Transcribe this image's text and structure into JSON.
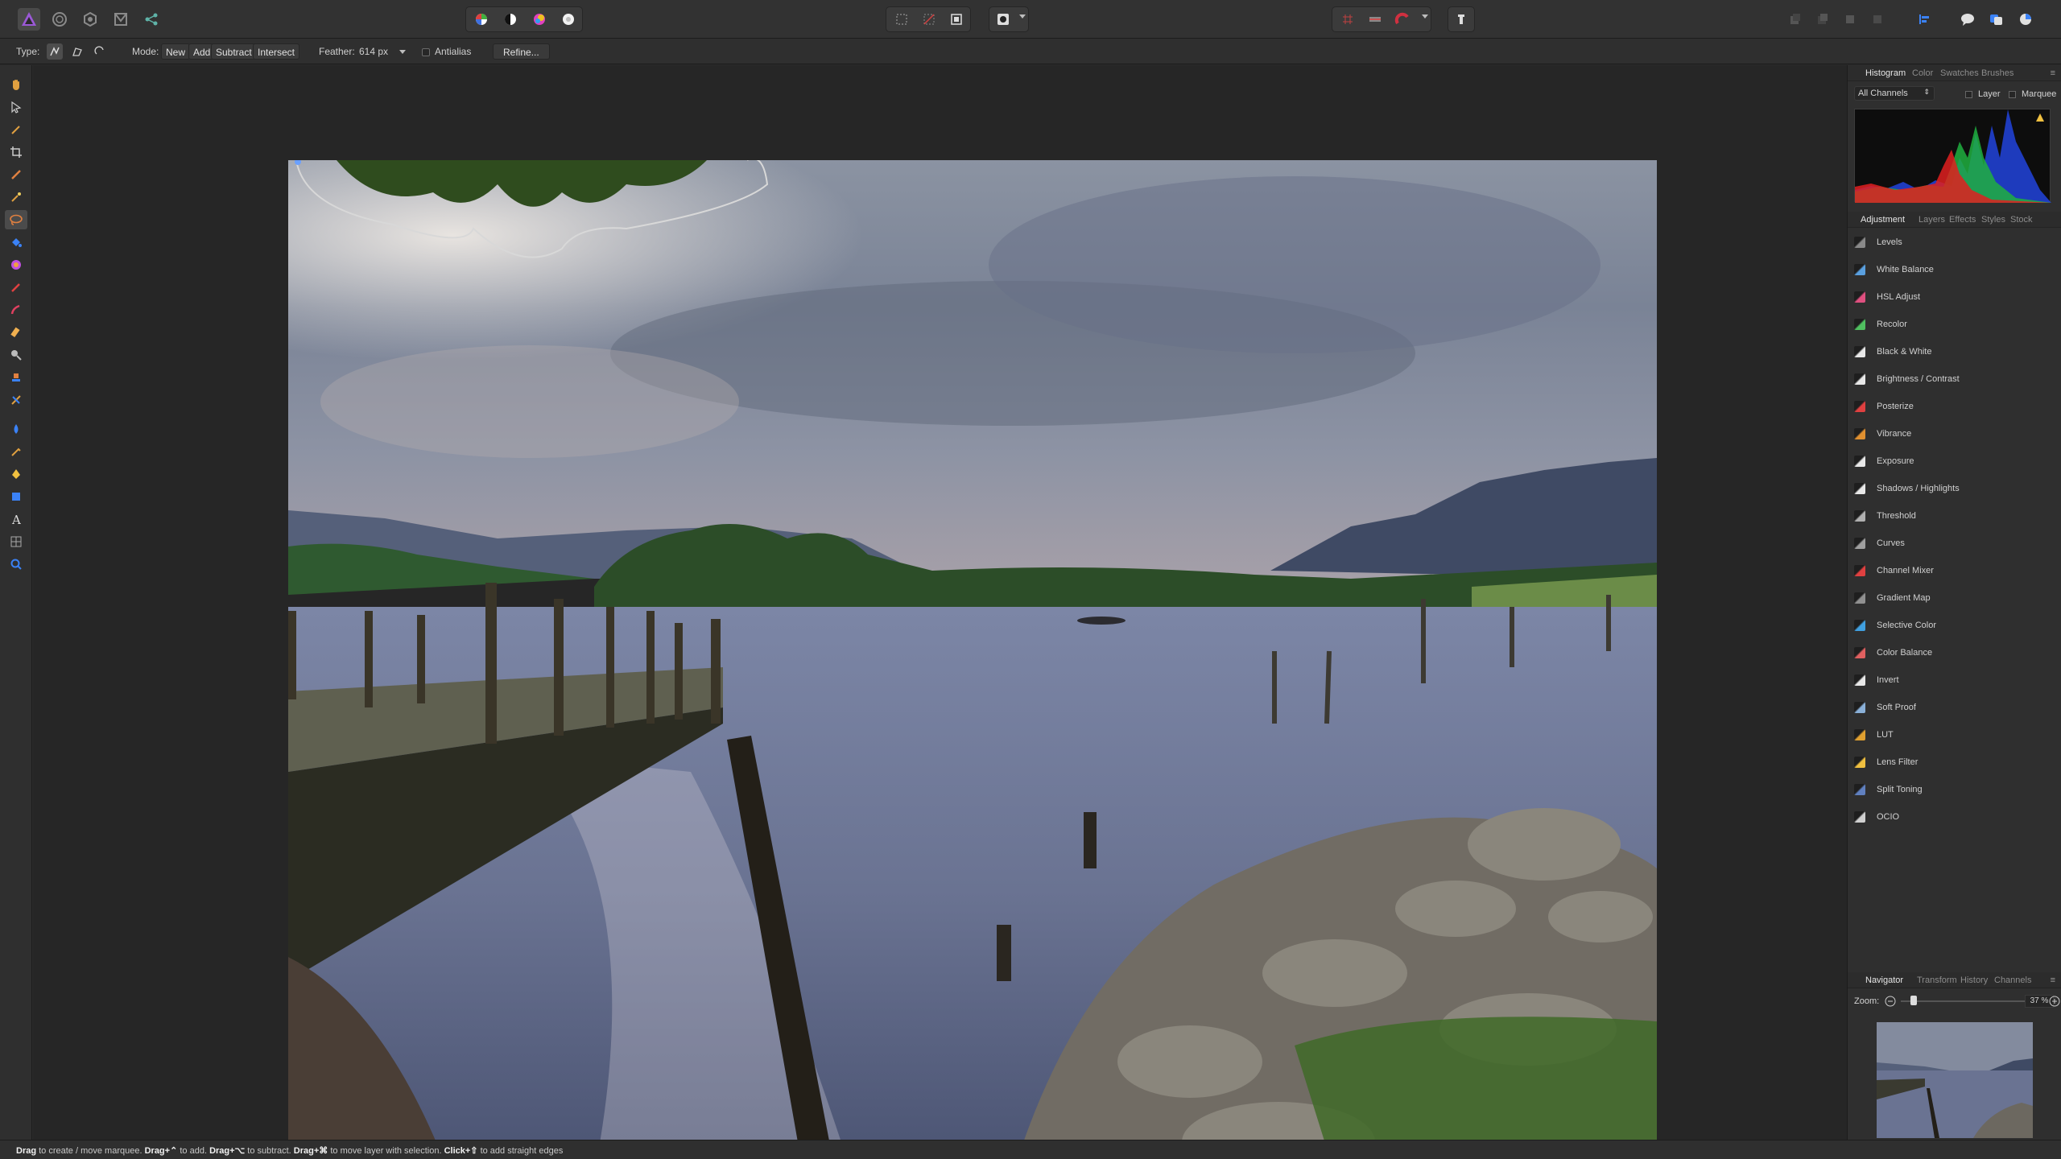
{
  "toolbar": {
    "personas": [
      "affinity-logo",
      "liquify-persona",
      "develop-persona",
      "tone-mapping-persona",
      "export-persona"
    ],
    "tools_groups": [
      "auto-levels",
      "auto-contrast",
      "auto-colors",
      "auto-white-balance"
    ]
  },
  "context": {
    "type_label": "Type:",
    "mode_label": "Mode:",
    "mode_new": "New",
    "mode_add": "Add",
    "mode_subtract": "Subtract",
    "mode_intersect": "Intersect",
    "feather_label": "Feather:",
    "feather_value": "614 px",
    "antialias_label": "Antialias",
    "refine_label": "Refine..."
  },
  "histogram_tabs": [
    "Histogram",
    "Color",
    "Swatches",
    "Brushes"
  ],
  "histogram": {
    "channel": "All Channels",
    "layer_label": "Layer",
    "marquee_label": "Marquee"
  },
  "adjust_tabs": [
    "Adjustment",
    "Layers",
    "Effects",
    "Styles",
    "Stock"
  ],
  "adjustments": [
    {
      "label": "Levels",
      "color": "#8a8a8a"
    },
    {
      "label": "White Balance",
      "color": "#5aa0e0"
    },
    {
      "label": "HSL Adjust",
      "color": "#e05080"
    },
    {
      "label": "Recolor",
      "color": "#50c060"
    },
    {
      "label": "Black & White",
      "color": "#e8e8e8"
    },
    {
      "label": "Brightness / Contrast",
      "color": "#e8e8e8"
    },
    {
      "label": "Posterize",
      "color": "#e04040"
    },
    {
      "label": "Vibrance",
      "color": "#e09030"
    },
    {
      "label": "Exposure",
      "color": "#e8e8e8"
    },
    {
      "label": "Shadows / Highlights",
      "color": "#e8e8e8"
    },
    {
      "label": "Threshold",
      "color": "#b0b0b0"
    },
    {
      "label": "Curves",
      "color": "#a0a0a0"
    },
    {
      "label": "Channel Mixer",
      "color": "#e04040"
    },
    {
      "label": "Gradient Map",
      "color": "#909090"
    },
    {
      "label": "Selective Color",
      "color": "#40a0e0"
    },
    {
      "label": "Color Balance",
      "color": "#e06060"
    },
    {
      "label": "Invert",
      "color": "#e8e8e8"
    },
    {
      "label": "Soft Proof",
      "color": "#8ab0d8"
    },
    {
      "label": "LUT",
      "color": "#e0a030"
    },
    {
      "label": "Lens Filter",
      "color": "#f0c040"
    },
    {
      "label": "Split Toning",
      "color": "#6080c0"
    },
    {
      "label": "OCIO",
      "color": "#d0d0d0"
    }
  ],
  "navigator_tabs": [
    "Navigator",
    "Transform",
    "History",
    "Channels"
  ],
  "navigator": {
    "zoom_label": "Zoom:",
    "zoom_value": "37 %"
  },
  "status": {
    "s1b": "Drag",
    "s1": "to create / move marquee.",
    "s2b": "Drag+⌃",
    "s2": "to add.",
    "s3b": "Drag+⌥",
    "s3": "to subtract.",
    "s4b": "Drag+⌘",
    "s4": "to move layer with selection.",
    "s5b": "Click+⇧",
    "s5": "to add straight edges"
  }
}
